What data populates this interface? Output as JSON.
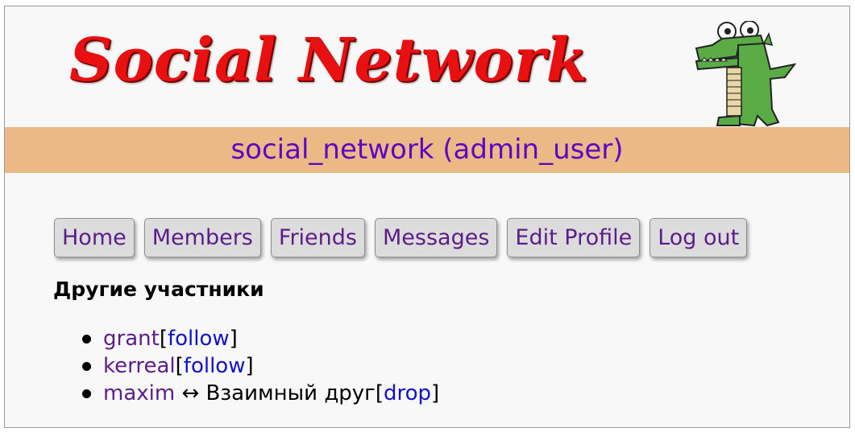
{
  "header": {
    "logo_text": "Social Network",
    "banner": "social_network (admin_user)"
  },
  "nav": {
    "home": "Home",
    "members": "Members",
    "friends": "Friends",
    "messages": "Messages",
    "edit_profile": "Edit Profile",
    "logout": "Log out"
  },
  "section_title": "Другие участники",
  "members": [
    {
      "name": "grant",
      "status": "",
      "open": "[",
      "action": "follow",
      "close": "]"
    },
    {
      "name": "kerreal",
      "status": "",
      "open": "[",
      "action": "follow",
      "close": "]"
    },
    {
      "name": "maxim",
      "status": " ↔ Взаимный друг",
      "open": "[",
      "action": "drop",
      "close": "]"
    }
  ],
  "colors": {
    "banner_bg": "#ebb886",
    "banner_text": "#5b06c2",
    "logo_red": "#e81010",
    "visited_link": "#5a1d8a",
    "link": "#1111cc",
    "mascot_green": "#5aab46"
  },
  "icons": {
    "mascot": "crocodile-mascot-icon"
  }
}
